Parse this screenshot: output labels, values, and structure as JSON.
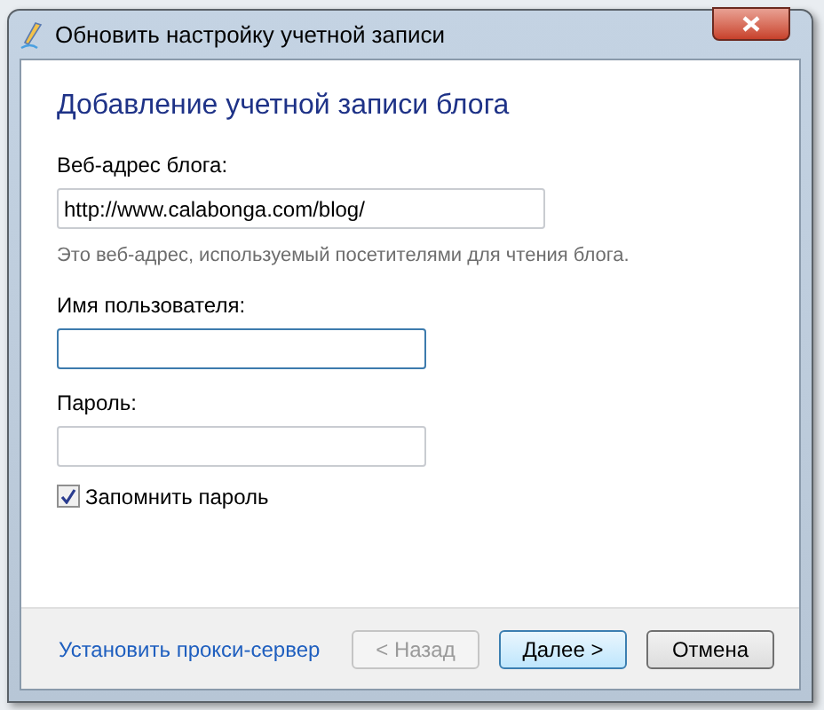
{
  "window": {
    "title": "Обновить настройку учетной записи"
  },
  "heading": "Добавление учетной записи блога",
  "fields": [
    {
      "label": "Веб-адрес блога:",
      "value": "http://www.calabonga.com/blog/",
      "hint": "Это веб-адрес, используемый посетителями для чтения блога.",
      "focused": false
    },
    {
      "label": "Имя пользователя:",
      "focused": true
    },
    {
      "label": "Пароль:",
      "focused": false
    }
  ],
  "remember": {
    "label": "Запомнить пароль",
    "checked": true
  },
  "footer": {
    "link": "Установить прокси-сервер",
    "buttons": [
      {
        "label": "< Назад",
        "disabled": true,
        "default": false
      },
      {
        "label": "Далее >",
        "disabled": false,
        "default": true
      },
      {
        "label": "Отмена",
        "disabled": false,
        "default": false
      }
    ]
  }
}
